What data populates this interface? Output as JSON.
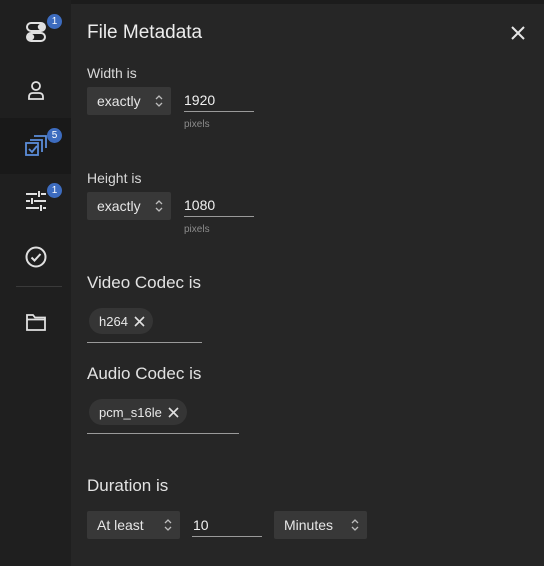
{
  "sidebar": {
    "items": [
      {
        "icon": "toggle-switches-icon",
        "badge": "1"
      },
      {
        "icon": "person-icon",
        "badge": ""
      },
      {
        "icon": "stacked-checkboxes-icon",
        "badge": "5",
        "active": true
      },
      {
        "icon": "sliders-icon",
        "badge": "1"
      },
      {
        "icon": "check-circle-icon",
        "badge": ""
      },
      {
        "icon": "folder-icon",
        "badge": ""
      }
    ]
  },
  "panel": {
    "title": "File Metadata",
    "width": {
      "label": "Width is",
      "operator": "exactly",
      "value": "1920",
      "unit": "pixels"
    },
    "height": {
      "label": "Height is",
      "operator": "exactly",
      "value": "1080",
      "unit": "pixels"
    },
    "video_codec": {
      "label": "Video Codec is",
      "chips": [
        "h264"
      ]
    },
    "audio_codec": {
      "label": "Audio Codec is",
      "chips": [
        "pcm_s16le"
      ]
    },
    "duration": {
      "label": "Duration is",
      "operator": "At least",
      "value": "10",
      "unit": "Minutes"
    }
  },
  "colors": {
    "badge": "#3d6cbf",
    "accent_active_icon": "#5b8dd9",
    "background": "#262626",
    "sidebar": "#1f1f1f"
  }
}
